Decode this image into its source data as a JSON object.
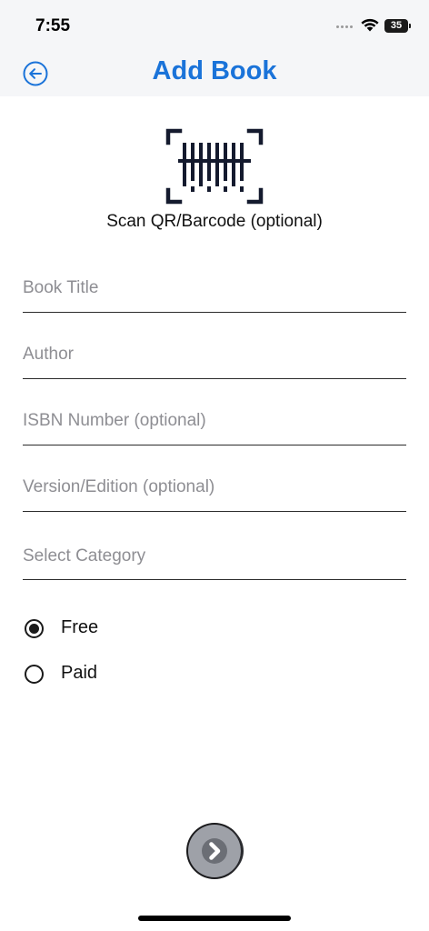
{
  "status_bar": {
    "time": "7:55",
    "battery": "35"
  },
  "header": {
    "title": "Add Book",
    "back_icon": "arrow-left-circle-icon",
    "accent_color": "#1a73d9"
  },
  "scan": {
    "label": "Scan QR/Barcode (optional)",
    "icon": "barcode-scan-icon"
  },
  "form": {
    "book_title": {
      "value": "",
      "placeholder": "Book Title"
    },
    "author": {
      "value": "",
      "placeholder": "Author"
    },
    "isbn": {
      "value": "",
      "placeholder": "ISBN Number (optional)"
    },
    "version": {
      "value": "",
      "placeholder": "Version/Edition (optional)"
    },
    "category": {
      "value": "",
      "placeholder": "Select Category"
    }
  },
  "pricing": {
    "options": [
      {
        "label": "Free",
        "selected": true
      },
      {
        "label": "Paid",
        "selected": false
      }
    ]
  },
  "next_button": {
    "icon": "chevron-right-icon"
  }
}
